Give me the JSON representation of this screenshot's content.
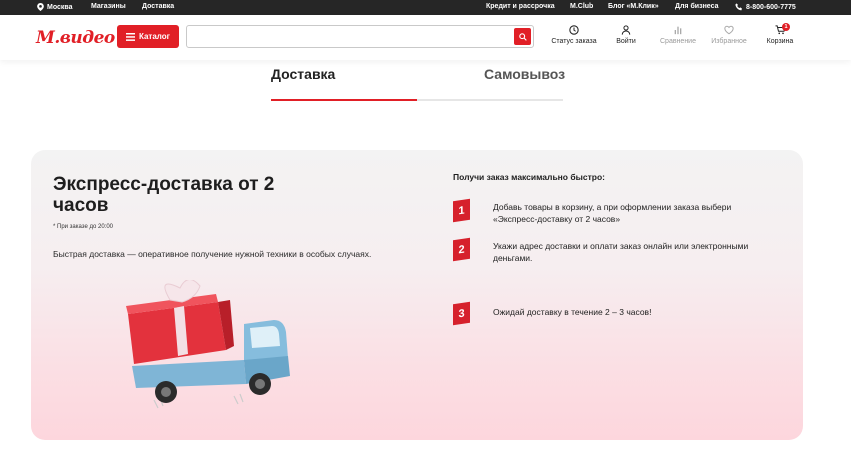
{
  "topbar": {
    "city": "Москва",
    "stores": "Магазины",
    "delivery": "Доставка",
    "credit": "Кредит и рассрочка",
    "mclub": "M.Club",
    "blog": "Блог «М.Клик»",
    "business": "Для бизнеса",
    "phone": "8-800-600-7775"
  },
  "header": {
    "logo": "М.видео",
    "catalog_label": "Каталог",
    "search_placeholder": "",
    "actions": {
      "order_status": "Статус заказа",
      "login": "Войти",
      "compare": "Сравнение",
      "favorites": "Избранное",
      "cart": "Корзина",
      "cart_count": "1"
    }
  },
  "tabs": [
    {
      "label": "Доставка",
      "active": true
    },
    {
      "label": "Самовывоз",
      "active": false
    }
  ],
  "promo": {
    "title": "Экспресс-доставка от 2 часов",
    "footnote": "* При заказе до 20:00",
    "description": "Быстрая доставка — оперативное получение нужной техники в особых случаях.",
    "steps_title": "Получи заказ максимально быстро:",
    "steps": [
      {
        "num": "1",
        "text": "Добавь товары в корзину, а при оформлении заказа выбери «Экспресс-доставку от 2 часов»"
      },
      {
        "num": "2",
        "text": "Укажи адрес доставки и оплати заказ онлайн или электронными деньгами."
      },
      {
        "num": "3",
        "text": "Ожидай доставку в течение 2 – 3 часов!"
      }
    ]
  },
  "colors": {
    "brand": "#e11f26",
    "topbar_bg": "#262626",
    "card_gradient_end": "#fdd6dd"
  },
  "icons": [
    "location-pin-icon",
    "phone-icon",
    "menu-icon",
    "search-icon",
    "clock-icon",
    "user-icon",
    "compare-chart-icon",
    "heart-icon",
    "cart-icon",
    "delivery-truck-gift-illustration"
  ]
}
